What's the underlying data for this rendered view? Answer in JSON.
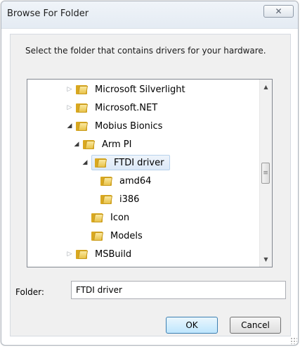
{
  "dialog": {
    "title": "Browse For Folder",
    "close_label": "✕",
    "prompt": "Select the folder that contains drivers for your hardware."
  },
  "tree": {
    "items": [
      {
        "label": "Microsoft Silverlight",
        "state": "collapsed"
      },
      {
        "label": "Microsoft.NET",
        "state": "collapsed"
      },
      {
        "label": "Mobius Bionics",
        "state": "expanded"
      },
      {
        "label": "Arm PI",
        "state": "expanded"
      },
      {
        "label": "FTDI driver",
        "state": "expanded",
        "selected": true
      },
      {
        "label": "amd64",
        "state": "leaf"
      },
      {
        "label": "i386",
        "state": "leaf"
      },
      {
        "label": "Icon",
        "state": "leaf"
      },
      {
        "label": "Models",
        "state": "leaf"
      },
      {
        "label": "MSBuild",
        "state": "collapsed"
      }
    ]
  },
  "folder_field": {
    "label": "Folder:",
    "value": "FTDI driver"
  },
  "buttons": {
    "ok": "OK",
    "cancel": "Cancel"
  },
  "icons": {
    "folder": "folder-icon",
    "close": "close-icon",
    "expand_arrow": "triangle-down-icon",
    "collapse_arrow": "triangle-right-icon"
  },
  "colors": {
    "selection_bg": "#dbe8f7",
    "folder_yellow": "#e8c24a",
    "ok_border": "#3c7fb1"
  }
}
